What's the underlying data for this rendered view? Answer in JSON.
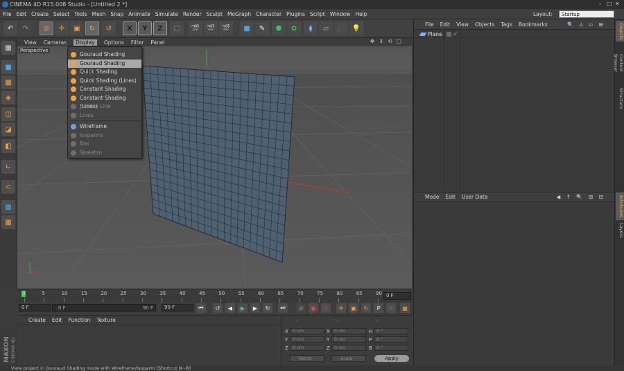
{
  "window": {
    "title": "CINEMA 4D R15.008 Studio - [Untitled 2 *]"
  },
  "menubar": {
    "items": [
      "File",
      "Edit",
      "Create",
      "Select",
      "Tools",
      "Mesh",
      "Snap",
      "Animate",
      "Simulate",
      "Render",
      "Sculpt",
      "MoGraph",
      "Character",
      "Plugins",
      "Script",
      "Window",
      "Help"
    ],
    "layout_label": "Layout:",
    "layout_value": "Startup"
  },
  "toolbar": {
    "axis_labels": [
      "X",
      "Y",
      "Z"
    ]
  },
  "viewport": {
    "menu": [
      "View",
      "Cameras",
      "Display",
      "Options",
      "Filter",
      "Panel"
    ],
    "active_menu": "Display",
    "label": "Perspective"
  },
  "display_menu": {
    "items": [
      {
        "label": "Gouraud Shading",
        "icon": "orange"
      },
      {
        "label": "Gouraud Shading (Lines)",
        "icon": "orange",
        "highlighted": true
      },
      {
        "label": "Quick Shading",
        "icon": "orange"
      },
      {
        "label": "Quick Shading (Lines)",
        "icon": "orange"
      },
      {
        "label": "Constant Shading",
        "icon": "orange"
      },
      {
        "label": "Constant Shading (Lines)",
        "icon": "orange"
      },
      {
        "label": "Hidden Line",
        "icon": "gray"
      },
      {
        "label": "Lines",
        "icon": "gray"
      },
      {
        "label": "Wireframe",
        "icon": "blue"
      },
      {
        "label": "Isoparms",
        "icon": "gray"
      },
      {
        "label": "Box",
        "icon": "gray"
      },
      {
        "label": "Skeleton",
        "icon": "gray"
      }
    ]
  },
  "timeline": {
    "ticks": [
      "0",
      "5",
      "10",
      "15",
      "20",
      "25",
      "30",
      "35",
      "40",
      "45",
      "50",
      "55",
      "60",
      "65",
      "70",
      "75",
      "80",
      "85",
      "90"
    ],
    "current_frame": "0 F"
  },
  "transport": {
    "start_field": "0 F",
    "min_field": "0 F",
    "max_field": "90 F",
    "end_field": "90 F"
  },
  "material_panel": {
    "menu": [
      "Create",
      "Edit",
      "Function",
      "Texture"
    ]
  },
  "coordinates": {
    "headers": [
      "--",
      "--",
      "--"
    ],
    "rows": [
      {
        "pos_label": "X",
        "pos": "0 cm",
        "size_label": "X",
        "size": "0 cm",
        "rot_label": "H",
        "rot": "0 °"
      },
      {
        "pos_label": "Y",
        "pos": "0 cm",
        "size_label": "Y",
        "size": "0 cm",
        "rot_label": "P",
        "rot": "0 °"
      },
      {
        "pos_label": "Z",
        "pos": "0 cm",
        "size_label": "Z",
        "size": "0 cm",
        "rot_label": "B",
        "rot": "0 °"
      }
    ],
    "world_select": "World",
    "scale_select": "Scale",
    "apply_label": "Apply"
  },
  "object_manager": {
    "menu": [
      "File",
      "Edit",
      "View",
      "Objects",
      "Tags",
      "Bookmarks"
    ],
    "object_name": "Plane"
  },
  "attribute_manager": {
    "menu": [
      "Mode",
      "Edit",
      "User Data"
    ]
  },
  "side_tabs": {
    "top": [
      "Objects",
      "Content Browser",
      "Structure"
    ],
    "bottom": [
      "Attributes",
      "Layers"
    ]
  },
  "maxon": {
    "brand": "MAXON",
    "product": "CINEMA 4D"
  },
  "status": {
    "text": "View project in Gouraud Shading  mode with Wireframe/Isoparm [Shortcut N~B]"
  },
  "colors": {
    "accent": "#f2a23a",
    "highlight": "#a9a9a9",
    "wire_blue": "#4f6070",
    "axis_red": "#c83a2a",
    "axis_green": "#3fae3f"
  }
}
